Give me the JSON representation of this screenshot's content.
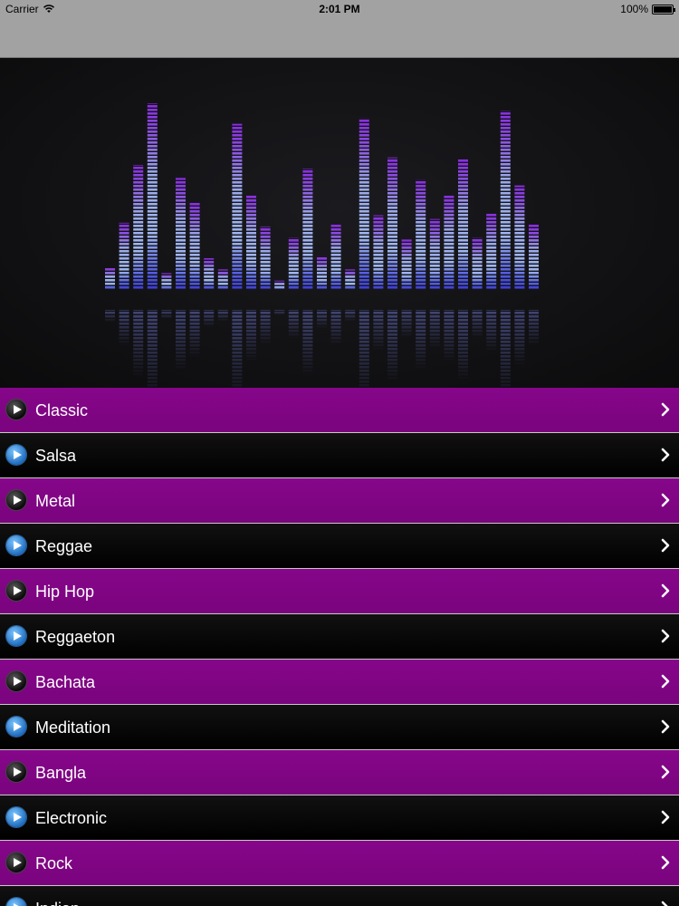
{
  "status_bar": {
    "carrier": "Carrier",
    "time": "2:01 PM",
    "battery": "100%"
  },
  "banner": {
    "equalizer_levels": [
      0.12,
      0.36,
      0.67,
      1.0,
      0.09,
      0.6,
      0.47,
      0.17,
      0.11,
      0.89,
      0.51,
      0.34,
      0.05,
      0.28,
      0.65,
      0.18,
      0.35,
      0.11,
      0.92,
      0.4,
      0.71,
      0.27,
      0.59,
      0.38,
      0.51,
      0.7,
      0.28,
      0.41,
      0.96,
      0.56,
      0.35
    ],
    "colors": {
      "low": "#3b3bd8",
      "mid": "#9fb6ee",
      "high": "#8a2be2"
    }
  },
  "genres": [
    {
      "label": "Classic",
      "style": "purple",
      "icon": "play-black-icon"
    },
    {
      "label": "Salsa",
      "style": "dark",
      "icon": "play-blue-icon"
    },
    {
      "label": "Metal",
      "style": "purple",
      "icon": "play-black-icon"
    },
    {
      "label": "Reggae",
      "style": "dark",
      "icon": "play-blue-icon"
    },
    {
      "label": "Hip Hop",
      "style": "purple",
      "icon": "play-black-icon"
    },
    {
      "label": "Reggaeton",
      "style": "dark",
      "icon": "play-blue-icon"
    },
    {
      "label": "Bachata",
      "style": "purple",
      "icon": "play-black-icon"
    },
    {
      "label": "Meditation",
      "style": "dark",
      "icon": "play-blue-icon"
    },
    {
      "label": "Bangla",
      "style": "purple",
      "icon": "play-black-icon"
    },
    {
      "label": "Electronic",
      "style": "dark",
      "icon": "play-blue-icon"
    },
    {
      "label": "Rock",
      "style": "purple",
      "icon": "play-black-icon"
    },
    {
      "label": "Indian",
      "style": "dark",
      "icon": "play-blue-icon"
    }
  ],
  "colors": {
    "purple_row": "#86068a",
    "dark_row": "#000000",
    "separator": "#c9c9c9"
  }
}
